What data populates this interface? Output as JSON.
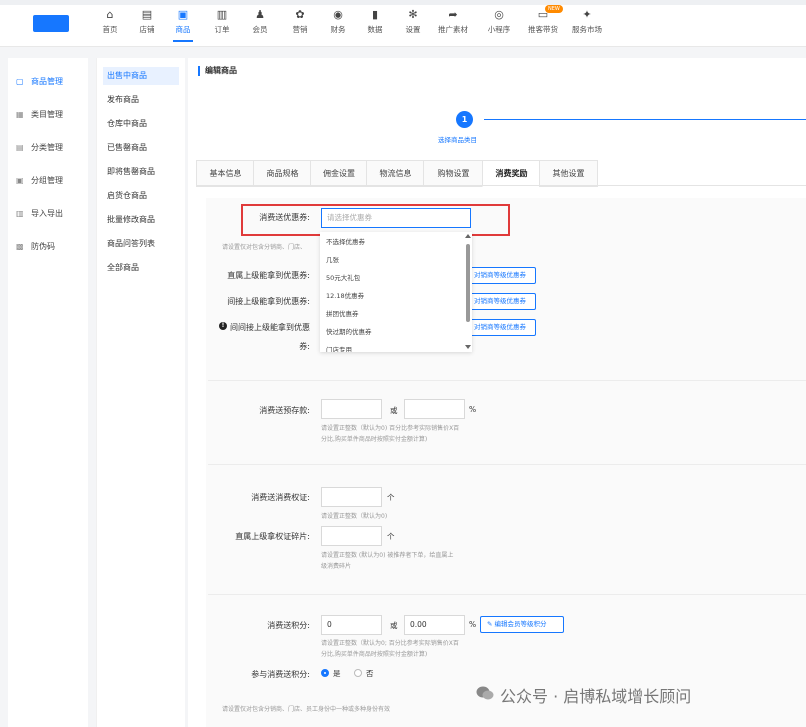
{
  "topnav": [
    {
      "label": "首页",
      "icon": "home-icon",
      "glyph": "⌂"
    },
    {
      "label": "店铺",
      "icon": "store-icon",
      "glyph": "▤"
    },
    {
      "label": "商品",
      "icon": "goods-icon",
      "glyph": "▣",
      "active": true
    },
    {
      "label": "订单",
      "icon": "order-icon",
      "glyph": "▥"
    },
    {
      "label": "会员",
      "icon": "member-icon",
      "glyph": "♟"
    },
    {
      "label": "营销",
      "icon": "marketing-icon",
      "glyph": "✿"
    },
    {
      "label": "财务",
      "icon": "finance-icon",
      "glyph": "◉"
    },
    {
      "label": "数据",
      "icon": "data-icon",
      "glyph": "▮"
    },
    {
      "label": "设置",
      "icon": "settings-icon",
      "glyph": "✻"
    },
    {
      "label": "推广素材",
      "icon": "promo-icon",
      "glyph": "➦"
    },
    {
      "label": "小程序",
      "icon": "miniprogram-icon",
      "glyph": "◎"
    },
    {
      "label": "推客带货",
      "icon": "affiliate-icon",
      "glyph": "▭",
      "badge": "NEW"
    },
    {
      "label": "服务市场",
      "icon": "market-icon",
      "glyph": "✦"
    }
  ],
  "sidebar": [
    {
      "label": "商品管理",
      "icon": "bag-icon",
      "active": true
    },
    {
      "label": "类目管理",
      "icon": "category-icon"
    },
    {
      "label": "分类管理",
      "icon": "list-icon"
    },
    {
      "label": "分组管理",
      "icon": "group-icon"
    },
    {
      "label": "导入导出",
      "icon": "import-icon"
    },
    {
      "label": "防伪码",
      "icon": "qrcode-icon"
    }
  ],
  "subnav": [
    {
      "label": "出售中商品",
      "active": true
    },
    {
      "label": "发布商品"
    },
    {
      "label": "仓库中商品"
    },
    {
      "label": "已售罄商品"
    },
    {
      "label": "即将售罄商品"
    },
    {
      "label": "启货仓商品"
    },
    {
      "label": "批量修改商品"
    },
    {
      "label": "商品问答列表"
    },
    {
      "label": "全部商品"
    }
  ],
  "breadcrumb": "编辑商品",
  "step": {
    "number": "1",
    "label": "选择商品类目"
  },
  "tabs": [
    "基本信息",
    "商品规格",
    "佣金设置",
    "物流信息",
    "购物设置",
    "消费奖励",
    "其他设置"
  ],
  "activeTab": "消费奖励",
  "coupon": {
    "label": "消费送优惠券:",
    "placeholder": "请选择优惠券",
    "options": [
      "不选择优惠券",
      "几张",
      "50元大礼包",
      "12.18优惠券",
      "拼团优惠券",
      "快过期的优惠券",
      "门店专用"
    ],
    "hint": "请设置仅对包含分销商、门店、",
    "direct_label": "直属上级能拿到优惠券:",
    "indirect_label": "间接上级能拿到优惠券:",
    "indirect2_label": "间间接上级能拿到优惠",
    "indirect2_label2": "券:",
    "btn_partial": "对销商等级优惠券"
  },
  "deposit": {
    "label": "消费送预存款:",
    "or": "或",
    "percent": "%",
    "hint1": "请设置正整数（默认为0) 百分比参考实际销售价X百",
    "hint2": "分比,购买单件商品时按照实付金额计算)"
  },
  "voucher": {
    "label": "消费送消费权证:",
    "unit": "个",
    "hint": "请设置正整数（默认为0)"
  },
  "fragment": {
    "label": "直属上级拿权证碎片:",
    "unit": "个",
    "hint1": "请设置正整数 (默认为0) 被推荐者下单，给直属上",
    "hint2": "级消费碎片"
  },
  "points": {
    "label": "消费送积分:",
    "value1": "0",
    "or": "或",
    "value2": "0.00",
    "percent": "%",
    "btn": "编辑会员等级积分",
    "hint1": "请设置正整数（默认为0; 百分比参考实际销售价X百",
    "hint2": "分比,购买单件商品时按照实付金额计算)"
  },
  "join": {
    "label": "参与消费送积分:",
    "yes": "是",
    "no": "否"
  },
  "footer_hint": "请设置仅对包含分销商、门店、员工身份中一种或多种身份有效",
  "watermark": "公众号 · 启博私域增长顾问",
  "colors": {
    "accent": "#1677ff",
    "highlight": "#e03a3a"
  }
}
